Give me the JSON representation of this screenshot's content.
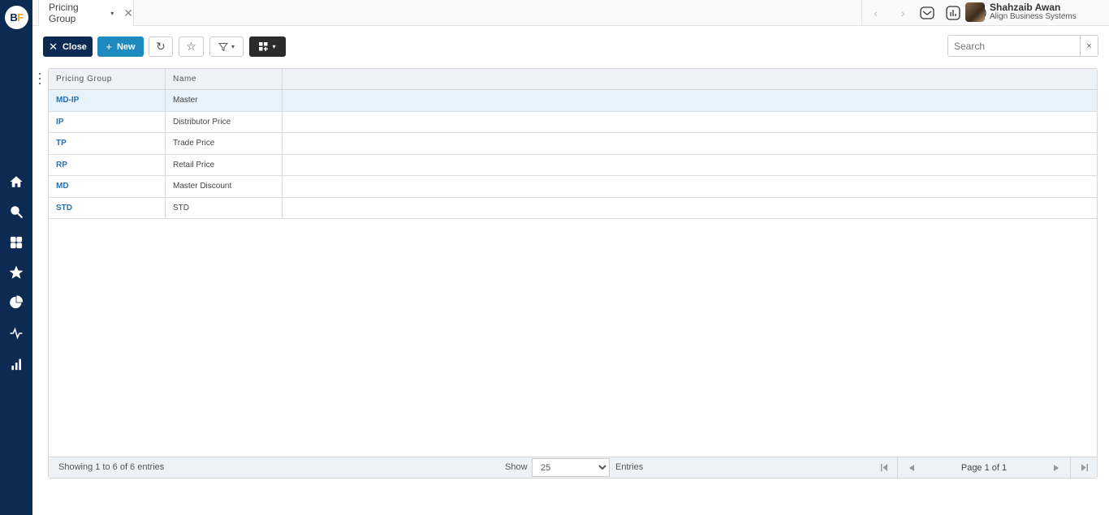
{
  "app": {
    "logo_b": "B",
    "logo_f": "F"
  },
  "sidebar": {
    "items": [
      {
        "name": "home",
        "icon": "home-icon"
      },
      {
        "name": "search",
        "icon": "search-icon"
      },
      {
        "name": "apps",
        "icon": "grid-icon"
      },
      {
        "name": "favorites",
        "icon": "star-icon"
      },
      {
        "name": "reports",
        "icon": "pie-chart-icon"
      },
      {
        "name": "activity",
        "icon": "activity-icon"
      },
      {
        "name": "analytics",
        "icon": "bar-chart-icon"
      }
    ]
  },
  "topbar": {
    "tab_label": "Pricing Group",
    "tab_caret": "▾",
    "tab_close": "✕",
    "nav_back": "‹",
    "nav_forward": "›",
    "user_name": "Shahzaib Awan",
    "user_org": "Align Business Systems"
  },
  "toolbar": {
    "close_label": "Close",
    "close_icon": "✕",
    "new_label": "New",
    "new_icon": "+",
    "refresh_icon": "↻",
    "favorite_icon": "☆",
    "filter_caret": "▾",
    "layout_caret": "▾",
    "search_placeholder": "Search",
    "search_clear": "×"
  },
  "grid": {
    "columns": [
      "Pricing Group",
      "Name"
    ],
    "rows": [
      {
        "code": "MD-IP",
        "name": "Master",
        "selected": true
      },
      {
        "code": "IP",
        "name": "Distributor Price"
      },
      {
        "code": "TP",
        "name": "Trade Price"
      },
      {
        "code": "RP",
        "name": "Retail Price"
      },
      {
        "code": "MD",
        "name": "Master Discount"
      },
      {
        "code": "STD",
        "name": "STD"
      }
    ]
  },
  "footer": {
    "showing": "Showing 1 to 6 of 6 entries",
    "show_label": "Show",
    "page_size": "25",
    "entries_label": "Entries",
    "page_info": "Page 1 of 1"
  },
  "colors": {
    "sidebar": "#0d2b52",
    "primary": "#1f8ac0",
    "link": "#2a6fb0",
    "selected_row": "#e6f3fd"
  }
}
